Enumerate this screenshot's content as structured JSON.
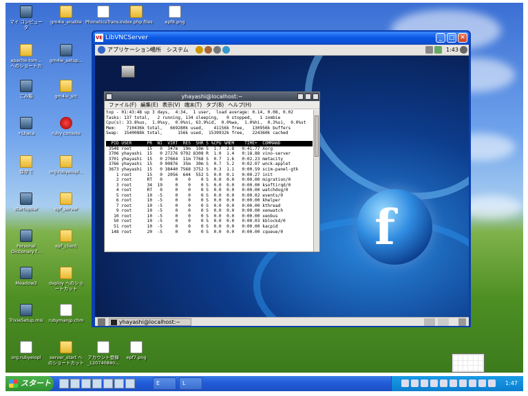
{
  "desktop": {
    "icons": [
      {
        "label": "マイ コンピュータ",
        "kind": "app"
      },
      {
        "label": "gm4ie_enable",
        "kind": "folder"
      },
      {
        "label": "PhoneticsTrans...",
        "kind": "file"
      },
      {
        "label": "index.php.files",
        "kind": "folder"
      },
      {
        "label": "epf8.png",
        "kind": "file"
      },
      {
        "label": "apache-tom... へのショートカ",
        "kind": "folder"
      },
      {
        "label": "gm4ie_setup...",
        "kind": "app"
      },
      {
        "label": "ごみ箱",
        "kind": "app"
      },
      {
        "label": "gm4ie_src",
        "kind": "folder"
      },
      {
        "label": "+Lhaca",
        "kind": "app"
      },
      {
        "label": "ruby console",
        "kind": "red"
      },
      {
        "label": "保存で",
        "kind": "folder"
      },
      {
        "label": "org.rubyeiopl...",
        "kind": "folder"
      },
      {
        "label": "startupbar",
        "kind": "app"
      },
      {
        "label": "epf_server",
        "kind": "folder"
      },
      {
        "label": "Personal Dictionary f...",
        "kind": "app"
      },
      {
        "label": "epf_client",
        "kind": "folder"
      },
      {
        "label": "Meadow3",
        "kind": "app"
      },
      {
        "label": "deploy へのショートカット",
        "kind": "folder"
      },
      {
        "label": "TrixieSetup.msi",
        "kind": "app"
      },
      {
        "label": "rubymanjp.chm",
        "kind": "file"
      },
      {
        "label": "org.rubyeiopl",
        "kind": "file"
      },
      {
        "label": "server_start へのショートカット",
        "kind": "folder"
      },
      {
        "label": "アカウント登録_120740840...",
        "kind": "file"
      },
      {
        "label": "epf7.png",
        "kind": "file"
      }
    ]
  },
  "taskbar": {
    "start_label": "スタート",
    "buttons": [
      "E",
      "L"
    ],
    "clock": "1:47"
  },
  "vnc": {
    "title": "LibVNCServer",
    "app_icon": "VE",
    "minimize": "_",
    "maximize": "□",
    "close": "✕",
    "gnome_top": {
      "menus": [
        "アプリケーション",
        "場所",
        "システム"
      ],
      "clock": "1:43"
    },
    "gnome_bottom": {
      "task_label": "yhayashi@localhost:~"
    }
  },
  "terminal": {
    "title": "yhayashi@localhost:~",
    "menu": [
      "ファイル(F)",
      "編集(E)",
      "表示(V)",
      "端末(T)",
      "タブ(B)",
      "ヘルプ(H)"
    ],
    "lines": [
      "top - 01:43:48 up 3 days,  4:34,  1 user,  load average: 0.14, 0.08, 0.02",
      "Tasks: 137 total,   2 running, 134 sleeping,   0 stopped,   1 zombie",
      "Cpu(s): 33.8%us,  1.0%sy,  0.0%ni, 63.9%id,  0.0%wa,  1.0%hi,  0.3%si,  0.0%st",
      "Mem:    710436k total,   669280k used,    41156k free,   130956k buffers",
      "Swap:  1540088k total,      156k used,  1539932k free,   224360k cached",
      ""
    ],
    "header": "  PID USER      PR  NI  VIRT  RES  SHR S %CPU %MEM    TIME+  COMMAND",
    "procs": [
      " 3548 root      15   0  347m  19m  10m S  1.7  2.8   0:41.77 Xorg",
      " 3706 yhayashi  15   0 27276 9792 8308 R  1.0  1.4   0:18.88 vino-server",
      " 3701 yhayashi  15   0 27664  11m 7768 S  0.7  1.6   0:02.23 metacity",
      " 3766 yhayashi  15   0 90876  35m  30m S  0.7  5.2   0:02.07 wnck-applet",
      " 3673 yhayashi  15   0 38440 7568 3752 S  0.3  1.1   0:00.59 scim-panel-gtk",
      "    1 root      15   0  2056  644  552 S  0.0  0.1   0:00.27 init",
      "    2 root      RT   0     0    0    0 S  0.0  0.0   0:00.00 migration/0",
      "    3 root      34  19     0    0    0 S  0.0  0.0   0:00.00 ksoftirqd/0",
      "    4 root      RT   0     0    0    0 S  0.0  0.0   0:00.00 watchdog/0",
      "    5 root      10  -5     0    0    0 S  0.0  0.0   0:00.02 events/0",
      "    6 root      10  -5     0    0    0 S  0.0  0.0   0:00.00 khelper",
      "    7 root      10  -5     0    0    0 S  0.0  0.0   0:00.00 kthread",
      "    9 root      10  -5     0    0    0 S  0.0  0.0   0:00.00 xenwatch",
      "   10 root      10  -5     0    0    0 S  0.0  0.0   0:00.00 xenbus",
      "   50 root      10  -5     0    0    0 S  0.0  0.0   0:00.03 kblockd/0",
      "   51 root      10  -5     0    0    0 S  0.0  0.0   0:00.00 kacpid",
      "  148 root      20  -5     0    0    0 S  0.0  0.0   0:00.00 cqueue/0"
    ]
  }
}
